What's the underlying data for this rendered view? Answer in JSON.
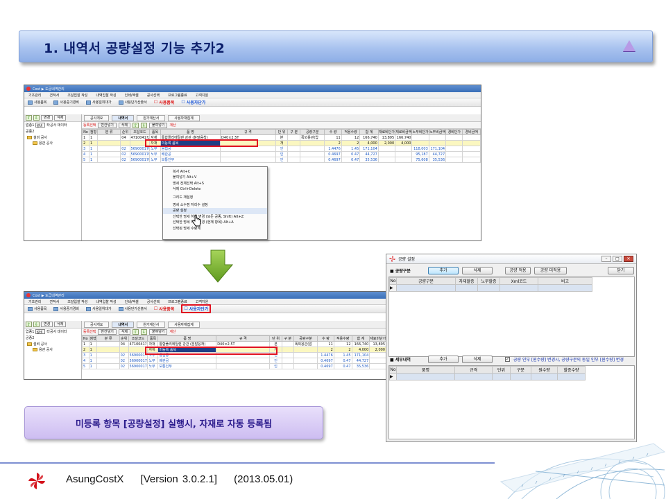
{
  "slide": {
    "title": "1. 내역서 공량설정 기능 추가2",
    "callout": "미등록 항목 [공량설정] 실행시, 자재로 자동 등록됨"
  },
  "footer": {
    "product": "AsungCostX",
    "version": "[Version 3.0.2.1]",
    "date": "(2013.05.01)"
  },
  "app": {
    "title": "Cost ▶ 도급내역관리",
    "menu": [
      "기초관리",
      "견적서",
      "조달입찰 작성",
      "내역입찰 작성",
      "인쇄/엑셀",
      "공사선택",
      "프로그램종료",
      "고객지원"
    ],
    "toolbar": {
      "btn1": "사용품목",
      "btn2": "사용중기경비",
      "btn3": "사용일위대가",
      "btn4": "사용단가산출서",
      "chk_item": "사용품목",
      "chk_price": "사용자단가"
    },
    "left": {
      "up": "⇧",
      "down": "⇩",
      "change": "변경",
      "delete": "삭제",
      "work_label": "업종1",
      "work_value": "설비",
      "other": "타공사 데이터",
      "work2_label": "공종2",
      "tree_root": "설비 공사",
      "tree_child": "용관 공사"
    },
    "tabs": {
      "t1": "공사개요",
      "t2": "내역서",
      "t3": "원가계산서",
      "t4": "사용자재집계"
    },
    "subbar": {
      "s1": "등록선택",
      "s2": "빈칸넣기",
      "s3": "삭제",
      "s4": "붙여넣기",
      "s5": "계산"
    },
    "columns": [
      "No",
      "첨형",
      "분 류",
      "순위",
      "조달코드",
      "품목",
      "품 명",
      "규 격",
      "단 위",
      "구 분",
      "공량구분",
      "수 량",
      "적용수량",
      "합 계",
      "재료비단가",
      "재료비금액",
      "노무비단가",
      "노무비금액",
      "경비단가",
      "경비금액"
    ],
    "rows": [
      {
        "no": "1",
        "form": "1",
        "cls": "",
        "rank": "04",
        "code": "4710041?225",
        "kind": "자재",
        "name": "통합폴리에틸렌 강관 (분말융착)",
        "spec": "D40×2.5T",
        "unit": "본",
        "gubun": "",
        "qtype": "폭외용관(압",
        "qty": "11",
        "aqty": "12",
        "sum": "166,740",
        "mp": "13,895",
        "ma": "166,740",
        "lp": "",
        "la": "",
        "ep": "",
        "ea": ""
      },
      {
        "no": "2",
        "form": "1",
        "cls": "",
        "rank": "",
        "code": "",
        "kind": "자재",
        "name": "미등록 품목",
        "spec": "",
        "unit": "개",
        "gubun": "",
        "qtype": "",
        "qty": "2",
        "aqty": "2",
        "sum": "4,000",
        "mp": "2,000",
        "ma": "4,000",
        "lp": "",
        "la": "",
        "ep": "",
        "ea": ""
      },
      {
        "no": "3",
        "form": "1",
        "cls": "",
        "rank": "02",
        "code": "56900017056",
        "kind": "노무",
        "name": "용접공",
        "spec": "",
        "unit": "인",
        "gubun": "",
        "qtype": "",
        "qty": "1.4476",
        "aqty": "1.45",
        "sum": "171,104",
        "mp": "",
        "ma": "",
        "lp": "118,003",
        "la": "171,104",
        "ep": "",
        "ea": ""
      },
      {
        "no": "4",
        "form": "1",
        "cls": "",
        "rank": "02",
        "code": "56900017030",
        "kind": "노무",
        "name": "배관공",
        "spec": "",
        "unit": "인",
        "gubun": "",
        "qtype": "",
        "qty": "0.4697",
        "aqty": "0.47",
        "sum": "44,727",
        "mp": "",
        "ma": "",
        "lp": "95,187",
        "la": "44,727",
        "ep": "",
        "ea": ""
      },
      {
        "no": "5",
        "form": "1",
        "cls": "",
        "rank": "02",
        "code": "56900017041",
        "kind": "노무",
        "name": "보통인부",
        "spec": "",
        "unit": "인",
        "gubun": "",
        "qtype": "",
        "qty": "0.4697",
        "aqty": "0.47",
        "sum": "35,536",
        "mp": "",
        "ma": "",
        "lp": "75,608",
        "la": "35,536",
        "ep": "",
        "ea": ""
      }
    ],
    "context_menu": [
      "복사 Alt+C",
      "붙여넣기 Alt+V",
      "명세 전체선택 Alt+S",
      "삭제 Ctrl+Delete",
      "그리드 재설정",
      "명세 소수점 자리수 설정",
      "공량 설정",
      "선택한 명세 하위 변경 (모든 공종, Shift) Alt+Z",
      "선택한 명세 하위 변경 (현재 항목) Alt+A",
      "선택된 명세 수량계"
    ]
  },
  "dialog": {
    "title": "공량 설정",
    "sec1_label": "공량구분",
    "add": "추가",
    "del": "삭제",
    "apply": "공량 적용",
    "unregistered": "공량 미적용",
    "close": "닫기",
    "grid1_cols": [
      "No",
      "공량구분",
      "자재할증",
      "노무할증",
      "Xml코드",
      "비고"
    ],
    "sec2_label": "세부내역",
    "add2": "추가",
    "del2": "삭제",
    "note": "공량 인부 [원수량] 변경시, 공량구분의 동일 인부 [원수량] 변경",
    "grid2_cols": [
      "No",
      "품명",
      "규격",
      "단위",
      "구분",
      "원수량",
      "할증수량"
    ]
  },
  "colors": {
    "accent": "#1e3f86",
    "highlight_box": "#e01020",
    "arrow": "#7ab32e"
  }
}
